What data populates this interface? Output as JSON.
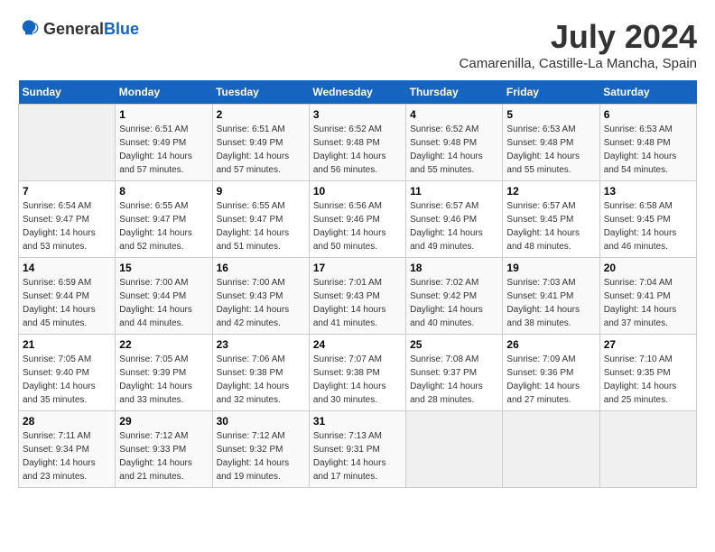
{
  "header": {
    "logo_general": "General",
    "logo_blue": "Blue",
    "month": "July 2024",
    "location": "Camarenilla, Castille-La Mancha, Spain"
  },
  "days_of_week": [
    "Sunday",
    "Monday",
    "Tuesday",
    "Wednesday",
    "Thursday",
    "Friday",
    "Saturday"
  ],
  "weeks": [
    [
      {
        "day": "",
        "sunrise": "",
        "sunset": "",
        "daylight": ""
      },
      {
        "day": "1",
        "sunrise": "Sunrise: 6:51 AM",
        "sunset": "Sunset: 9:49 PM",
        "daylight": "Daylight: 14 hours and 57 minutes."
      },
      {
        "day": "2",
        "sunrise": "Sunrise: 6:51 AM",
        "sunset": "Sunset: 9:49 PM",
        "daylight": "Daylight: 14 hours and 57 minutes."
      },
      {
        "day": "3",
        "sunrise": "Sunrise: 6:52 AM",
        "sunset": "Sunset: 9:48 PM",
        "daylight": "Daylight: 14 hours and 56 minutes."
      },
      {
        "day": "4",
        "sunrise": "Sunrise: 6:52 AM",
        "sunset": "Sunset: 9:48 PM",
        "daylight": "Daylight: 14 hours and 55 minutes."
      },
      {
        "day": "5",
        "sunrise": "Sunrise: 6:53 AM",
        "sunset": "Sunset: 9:48 PM",
        "daylight": "Daylight: 14 hours and 55 minutes."
      },
      {
        "day": "6",
        "sunrise": "Sunrise: 6:53 AM",
        "sunset": "Sunset: 9:48 PM",
        "daylight": "Daylight: 14 hours and 54 minutes."
      }
    ],
    [
      {
        "day": "7",
        "sunrise": "Sunrise: 6:54 AM",
        "sunset": "Sunset: 9:47 PM",
        "daylight": "Daylight: 14 hours and 53 minutes."
      },
      {
        "day": "8",
        "sunrise": "Sunrise: 6:55 AM",
        "sunset": "Sunset: 9:47 PM",
        "daylight": "Daylight: 14 hours and 52 minutes."
      },
      {
        "day": "9",
        "sunrise": "Sunrise: 6:55 AM",
        "sunset": "Sunset: 9:47 PM",
        "daylight": "Daylight: 14 hours and 51 minutes."
      },
      {
        "day": "10",
        "sunrise": "Sunrise: 6:56 AM",
        "sunset": "Sunset: 9:46 PM",
        "daylight": "Daylight: 14 hours and 50 minutes."
      },
      {
        "day": "11",
        "sunrise": "Sunrise: 6:57 AM",
        "sunset": "Sunset: 9:46 PM",
        "daylight": "Daylight: 14 hours and 49 minutes."
      },
      {
        "day": "12",
        "sunrise": "Sunrise: 6:57 AM",
        "sunset": "Sunset: 9:45 PM",
        "daylight": "Daylight: 14 hours and 48 minutes."
      },
      {
        "day": "13",
        "sunrise": "Sunrise: 6:58 AM",
        "sunset": "Sunset: 9:45 PM",
        "daylight": "Daylight: 14 hours and 46 minutes."
      }
    ],
    [
      {
        "day": "14",
        "sunrise": "Sunrise: 6:59 AM",
        "sunset": "Sunset: 9:44 PM",
        "daylight": "Daylight: 14 hours and 45 minutes."
      },
      {
        "day": "15",
        "sunrise": "Sunrise: 7:00 AM",
        "sunset": "Sunset: 9:44 PM",
        "daylight": "Daylight: 14 hours and 44 minutes."
      },
      {
        "day": "16",
        "sunrise": "Sunrise: 7:00 AM",
        "sunset": "Sunset: 9:43 PM",
        "daylight": "Daylight: 14 hours and 42 minutes."
      },
      {
        "day": "17",
        "sunrise": "Sunrise: 7:01 AM",
        "sunset": "Sunset: 9:43 PM",
        "daylight": "Daylight: 14 hours and 41 minutes."
      },
      {
        "day": "18",
        "sunrise": "Sunrise: 7:02 AM",
        "sunset": "Sunset: 9:42 PM",
        "daylight": "Daylight: 14 hours and 40 minutes."
      },
      {
        "day": "19",
        "sunrise": "Sunrise: 7:03 AM",
        "sunset": "Sunset: 9:41 PM",
        "daylight": "Daylight: 14 hours and 38 minutes."
      },
      {
        "day": "20",
        "sunrise": "Sunrise: 7:04 AM",
        "sunset": "Sunset: 9:41 PM",
        "daylight": "Daylight: 14 hours and 37 minutes."
      }
    ],
    [
      {
        "day": "21",
        "sunrise": "Sunrise: 7:05 AM",
        "sunset": "Sunset: 9:40 PM",
        "daylight": "Daylight: 14 hours and 35 minutes."
      },
      {
        "day": "22",
        "sunrise": "Sunrise: 7:05 AM",
        "sunset": "Sunset: 9:39 PM",
        "daylight": "Daylight: 14 hours and 33 minutes."
      },
      {
        "day": "23",
        "sunrise": "Sunrise: 7:06 AM",
        "sunset": "Sunset: 9:38 PM",
        "daylight": "Daylight: 14 hours and 32 minutes."
      },
      {
        "day": "24",
        "sunrise": "Sunrise: 7:07 AM",
        "sunset": "Sunset: 9:38 PM",
        "daylight": "Daylight: 14 hours and 30 minutes."
      },
      {
        "day": "25",
        "sunrise": "Sunrise: 7:08 AM",
        "sunset": "Sunset: 9:37 PM",
        "daylight": "Daylight: 14 hours and 28 minutes."
      },
      {
        "day": "26",
        "sunrise": "Sunrise: 7:09 AM",
        "sunset": "Sunset: 9:36 PM",
        "daylight": "Daylight: 14 hours and 27 minutes."
      },
      {
        "day": "27",
        "sunrise": "Sunrise: 7:10 AM",
        "sunset": "Sunset: 9:35 PM",
        "daylight": "Daylight: 14 hours and 25 minutes."
      }
    ],
    [
      {
        "day": "28",
        "sunrise": "Sunrise: 7:11 AM",
        "sunset": "Sunset: 9:34 PM",
        "daylight": "Daylight: 14 hours and 23 minutes."
      },
      {
        "day": "29",
        "sunrise": "Sunrise: 7:12 AM",
        "sunset": "Sunset: 9:33 PM",
        "daylight": "Daylight: 14 hours and 21 minutes."
      },
      {
        "day": "30",
        "sunrise": "Sunrise: 7:12 AM",
        "sunset": "Sunset: 9:32 PM",
        "daylight": "Daylight: 14 hours and 19 minutes."
      },
      {
        "day": "31",
        "sunrise": "Sunrise: 7:13 AM",
        "sunset": "Sunset: 9:31 PM",
        "daylight": "Daylight: 14 hours and 17 minutes."
      },
      {
        "day": "",
        "sunrise": "",
        "sunset": "",
        "daylight": ""
      },
      {
        "day": "",
        "sunrise": "",
        "sunset": "",
        "daylight": ""
      },
      {
        "day": "",
        "sunrise": "",
        "sunset": "",
        "daylight": ""
      }
    ]
  ]
}
